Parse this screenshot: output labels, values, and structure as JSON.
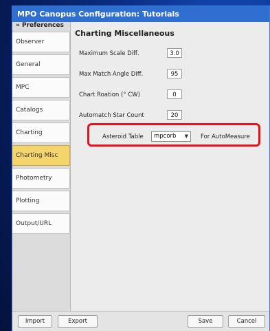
{
  "window": {
    "title": "MPO Canopus Configuration: Tutorials"
  },
  "sidebar": {
    "header": "» Preferences",
    "items": [
      {
        "label": "Observer"
      },
      {
        "label": "General"
      },
      {
        "label": "MPC"
      },
      {
        "label": "Catalogs"
      },
      {
        "label": "Charting"
      },
      {
        "label": "Charting Misc"
      },
      {
        "label": "Photometry"
      },
      {
        "label": "Plotting"
      },
      {
        "label": "Output/URL"
      }
    ],
    "active_index": 5
  },
  "main": {
    "section_title": "Charting Miscellaneous",
    "fields": {
      "max_scale_diff": {
        "label": "Maximum Scale Diff.",
        "value": "3.0"
      },
      "max_match_angle": {
        "label": "Max Match Angle Diff.",
        "value": "95"
      },
      "chart_rotation": {
        "label": "Chart Roation (° CW)",
        "value": "0"
      },
      "automatch_count": {
        "label": "Automatch Star Count",
        "value": "20"
      }
    },
    "asteroid_table": {
      "label": "Asteroid Table",
      "selected": "mpcorb",
      "suffix": "For AutoMeasure"
    }
  },
  "buttons": {
    "import": "Import",
    "export": "Export",
    "save": "Save",
    "cancel": "Cancel"
  },
  "colors": {
    "titlebar": "#2f6fd0",
    "active_tab": "#f4d46c",
    "highlight": "#e8101a"
  }
}
